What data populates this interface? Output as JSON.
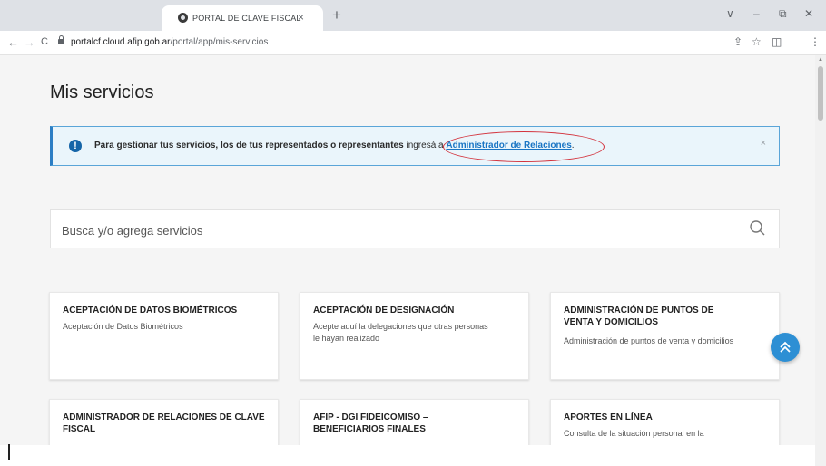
{
  "browser": {
    "tab_title": "PORTAL DE CLAVE FISCAL",
    "tab_close": "×",
    "new_tab": "+",
    "window_controls": {
      "dropdown": "∨",
      "minimize": "–",
      "restore": "⧉",
      "close": "✕"
    },
    "nav": {
      "back": "←",
      "forward": "→",
      "reload": "C"
    },
    "url_host": "portalcf.cloud.afip.gob.ar",
    "url_path": "/portal/app/mis-servicios",
    "toolbar_icons": {
      "share": "⇪",
      "bookmark": "☆",
      "sidepanel": "◫",
      "menu": "⋮"
    }
  },
  "page": {
    "title": "Mis servicios",
    "banner": {
      "text_bold": "Para gestionar tus servicios, los de tus representados o representantes",
      "text_normal": " ingresá a ",
      "link": "Administrador de Relaciones",
      "suffix": ".",
      "close": "×",
      "annotation_color": "#d3323c"
    },
    "search": {
      "placeholder": "Busca y/o agrega servicios"
    },
    "cards": [
      {
        "title": "ACEPTACIÓN DE DATOS BIOMÉTRICOS",
        "description": "Aceptación de Datos Biométricos"
      },
      {
        "title": "ACEPTACIÓN DE DESIGNACIÓN",
        "description": "Acepte aquí la delegaciones que otras personas le hayan realizado"
      },
      {
        "title": "ADMINISTRACIÓN DE PUNTOS DE VENTA Y DOMICILIOS",
        "description": "Administración de puntos de venta y domicilios"
      },
      {
        "title": "ADMINISTRADOR DE RELACIONES DE CLAVE FISCAL",
        "description": ""
      },
      {
        "title": "AFIP - DGI FIDEICOMISO – BENEFICIARIOS FINALES",
        "description": ""
      },
      {
        "title": "APORTES EN LÍNEA",
        "description": "Consulta de la situación personal en la"
      }
    ],
    "accent_color": "#2d8fd4"
  }
}
